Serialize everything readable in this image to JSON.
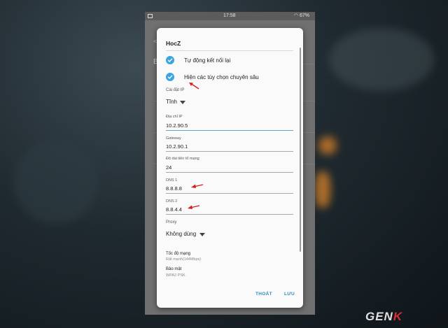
{
  "status_bar": {
    "time": "17:58",
    "battery": "67%"
  },
  "background_screen": {
    "first_letter": "B"
  },
  "dialog": {
    "title": "HocZ",
    "checkboxes": [
      {
        "label": "Tự động kết nối lại",
        "checked": true
      },
      {
        "label": "Hiện các tùy chọn chuyên sâu",
        "checked": true
      }
    ],
    "ip_settings": {
      "label": "Cài đặt IP",
      "value": "Tĩnh"
    },
    "fields": [
      {
        "label": "Địa chỉ IP",
        "value": "10.2.90.5"
      },
      {
        "label": "Gateway",
        "value": "10.2.90.1"
      },
      {
        "label": "Độ dài tiền tố mạng",
        "value": "24"
      },
      {
        "label": "DNS 1",
        "value": "8.8.8.8"
      },
      {
        "label": "DNS 2",
        "value": "8.8.4.4"
      }
    ],
    "proxy": {
      "label": "Proxy",
      "value": "Không dùng"
    },
    "link_speed": {
      "label": "Tốc độ mạng",
      "value": "Rất mạnh(144Mbps)"
    },
    "security": {
      "label": "Bảo mật",
      "value": "WPA2 PSK"
    },
    "buttons": {
      "cancel": "THOÁT",
      "save": "LƯU"
    }
  },
  "watermark": {
    "text_main": "GEN",
    "text_accent": "K"
  },
  "colors": {
    "accent": "#3aa6dd",
    "arrow": "#d32020"
  }
}
